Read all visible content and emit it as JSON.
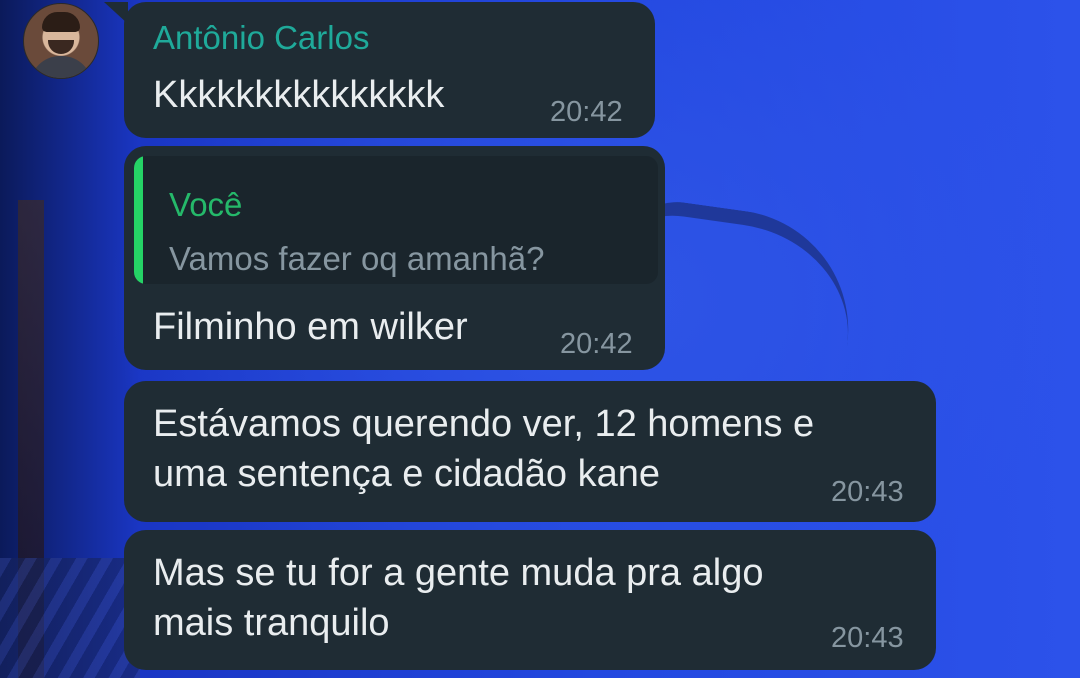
{
  "chat": {
    "contact_name": "Antônio Carlos",
    "avatar_icon": "profile-photo",
    "bubble_color": "#1f2c34",
    "wallpaper_color": "#1f3fd0",
    "messages": [
      {
        "text": "Kkkkkkkkkkkkkkk",
        "time": "20:42"
      },
      {
        "quote_author": "Você",
        "quote_text": "Vamos fazer oq amanhã?",
        "text": "Filminho em wilker",
        "time": "20:42"
      },
      {
        "text": "Estávamos querendo ver, 12 homens e\numa sentença e cidadão kane",
        "time": "20:43"
      },
      {
        "text": "Mas se tu for a gente muda pra algo\nmais tranquilo",
        "time": "20:43"
      }
    ]
  }
}
